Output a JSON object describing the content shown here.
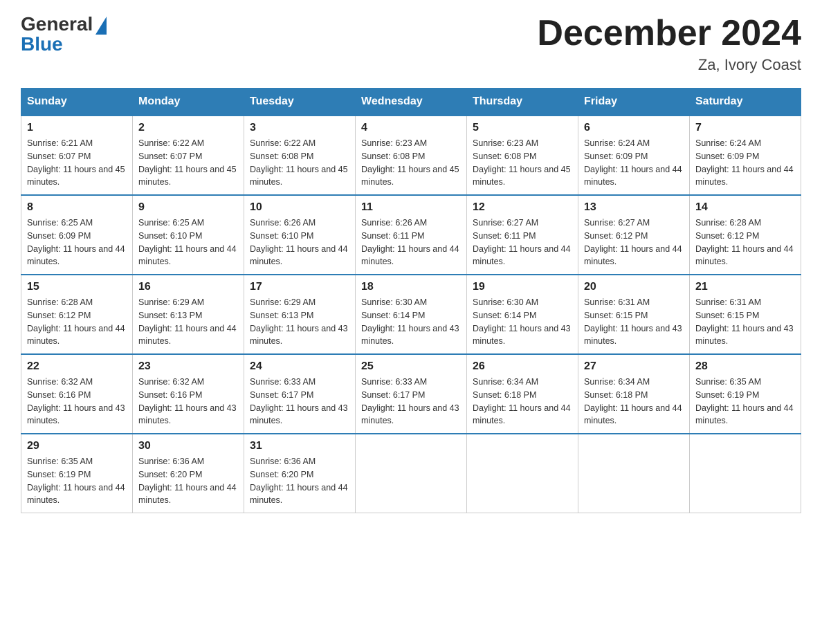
{
  "logo": {
    "general": "General",
    "blue": "Blue"
  },
  "title": "December 2024",
  "location": "Za, Ivory Coast",
  "days_of_week": [
    "Sunday",
    "Monday",
    "Tuesday",
    "Wednesday",
    "Thursday",
    "Friday",
    "Saturday"
  ],
  "weeks": [
    [
      {
        "day": "1",
        "sunrise": "6:21 AM",
        "sunset": "6:07 PM",
        "daylight": "11 hours and 45 minutes."
      },
      {
        "day": "2",
        "sunrise": "6:22 AM",
        "sunset": "6:07 PM",
        "daylight": "11 hours and 45 minutes."
      },
      {
        "day": "3",
        "sunrise": "6:22 AM",
        "sunset": "6:08 PM",
        "daylight": "11 hours and 45 minutes."
      },
      {
        "day": "4",
        "sunrise": "6:23 AM",
        "sunset": "6:08 PM",
        "daylight": "11 hours and 45 minutes."
      },
      {
        "day": "5",
        "sunrise": "6:23 AM",
        "sunset": "6:08 PM",
        "daylight": "11 hours and 45 minutes."
      },
      {
        "day": "6",
        "sunrise": "6:24 AM",
        "sunset": "6:09 PM",
        "daylight": "11 hours and 44 minutes."
      },
      {
        "day": "7",
        "sunrise": "6:24 AM",
        "sunset": "6:09 PM",
        "daylight": "11 hours and 44 minutes."
      }
    ],
    [
      {
        "day": "8",
        "sunrise": "6:25 AM",
        "sunset": "6:09 PM",
        "daylight": "11 hours and 44 minutes."
      },
      {
        "day": "9",
        "sunrise": "6:25 AM",
        "sunset": "6:10 PM",
        "daylight": "11 hours and 44 minutes."
      },
      {
        "day": "10",
        "sunrise": "6:26 AM",
        "sunset": "6:10 PM",
        "daylight": "11 hours and 44 minutes."
      },
      {
        "day": "11",
        "sunrise": "6:26 AM",
        "sunset": "6:11 PM",
        "daylight": "11 hours and 44 minutes."
      },
      {
        "day": "12",
        "sunrise": "6:27 AM",
        "sunset": "6:11 PM",
        "daylight": "11 hours and 44 minutes."
      },
      {
        "day": "13",
        "sunrise": "6:27 AM",
        "sunset": "6:12 PM",
        "daylight": "11 hours and 44 minutes."
      },
      {
        "day": "14",
        "sunrise": "6:28 AM",
        "sunset": "6:12 PM",
        "daylight": "11 hours and 44 minutes."
      }
    ],
    [
      {
        "day": "15",
        "sunrise": "6:28 AM",
        "sunset": "6:12 PM",
        "daylight": "11 hours and 44 minutes."
      },
      {
        "day": "16",
        "sunrise": "6:29 AM",
        "sunset": "6:13 PM",
        "daylight": "11 hours and 44 minutes."
      },
      {
        "day": "17",
        "sunrise": "6:29 AM",
        "sunset": "6:13 PM",
        "daylight": "11 hours and 43 minutes."
      },
      {
        "day": "18",
        "sunrise": "6:30 AM",
        "sunset": "6:14 PM",
        "daylight": "11 hours and 43 minutes."
      },
      {
        "day": "19",
        "sunrise": "6:30 AM",
        "sunset": "6:14 PM",
        "daylight": "11 hours and 43 minutes."
      },
      {
        "day": "20",
        "sunrise": "6:31 AM",
        "sunset": "6:15 PM",
        "daylight": "11 hours and 43 minutes."
      },
      {
        "day": "21",
        "sunrise": "6:31 AM",
        "sunset": "6:15 PM",
        "daylight": "11 hours and 43 minutes."
      }
    ],
    [
      {
        "day": "22",
        "sunrise": "6:32 AM",
        "sunset": "6:16 PM",
        "daylight": "11 hours and 43 minutes."
      },
      {
        "day": "23",
        "sunrise": "6:32 AM",
        "sunset": "6:16 PM",
        "daylight": "11 hours and 43 minutes."
      },
      {
        "day": "24",
        "sunrise": "6:33 AM",
        "sunset": "6:17 PM",
        "daylight": "11 hours and 43 minutes."
      },
      {
        "day": "25",
        "sunrise": "6:33 AM",
        "sunset": "6:17 PM",
        "daylight": "11 hours and 43 minutes."
      },
      {
        "day": "26",
        "sunrise": "6:34 AM",
        "sunset": "6:18 PM",
        "daylight": "11 hours and 44 minutes."
      },
      {
        "day": "27",
        "sunrise": "6:34 AM",
        "sunset": "6:18 PM",
        "daylight": "11 hours and 44 minutes."
      },
      {
        "day": "28",
        "sunrise": "6:35 AM",
        "sunset": "6:19 PM",
        "daylight": "11 hours and 44 minutes."
      }
    ],
    [
      {
        "day": "29",
        "sunrise": "6:35 AM",
        "sunset": "6:19 PM",
        "daylight": "11 hours and 44 minutes."
      },
      {
        "day": "30",
        "sunrise": "6:36 AM",
        "sunset": "6:20 PM",
        "daylight": "11 hours and 44 minutes."
      },
      {
        "day": "31",
        "sunrise": "6:36 AM",
        "sunset": "6:20 PM",
        "daylight": "11 hours and 44 minutes."
      },
      null,
      null,
      null,
      null
    ]
  ]
}
